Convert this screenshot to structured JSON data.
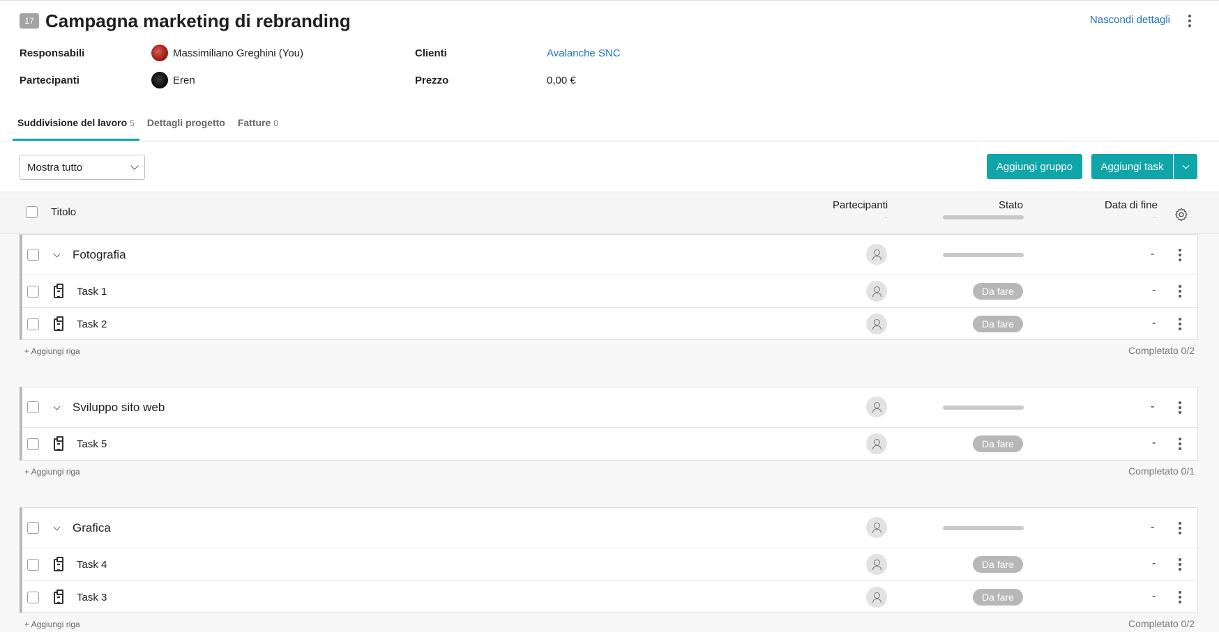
{
  "project": {
    "id": "17",
    "title": "Campagna marketing di rebranding",
    "hide_details": "Nascondi dettagli"
  },
  "info": {
    "responsabili_label": "Responsabili",
    "responsabili_value": "Massimiliano Greghini (You)",
    "partecipanti_label": "Partecipanti",
    "partecipanti_value": "Eren",
    "clienti_label": "Clienti",
    "clienti_value": "Avalanche SNC",
    "prezzo_label": "Prezzo",
    "prezzo_value": "0,00 €"
  },
  "tabs": [
    {
      "label": "Suddivisione del lavoro",
      "count": "5"
    },
    {
      "label": "Dettagli progetto",
      "count": ""
    },
    {
      "label": "Fatture",
      "count": "0"
    }
  ],
  "toolbar": {
    "filter_value": "Mostra tutto",
    "add_group": "Aggiungi gruppo",
    "add_task": "Aggiungi task"
  },
  "table_header": {
    "title": "Titolo",
    "participants": "Partecipanti",
    "participants_dash": "-",
    "status": "Stato",
    "end_date": "Data di fine",
    "end_date_dash": "-"
  },
  "groups": [
    {
      "name": "Fotografia",
      "date": "-",
      "tasks": [
        {
          "name": "Task 1",
          "status": "Da fare",
          "date": "-"
        },
        {
          "name": "Task 2",
          "status": "Da fare",
          "date": "-"
        }
      ],
      "add_row": "+ Aggiungi riga",
      "completed": "Completato 0/2"
    },
    {
      "name": "Sviluppo sito web",
      "date": "-",
      "tasks": [
        {
          "name": "Task 5",
          "status": "Da fare",
          "date": "-"
        }
      ],
      "add_row": "+ Aggiungi riga",
      "completed": "Completato 0/1"
    },
    {
      "name": "Grafica",
      "date": "-",
      "tasks": [
        {
          "name": "Task 4",
          "status": "Da fare",
          "date": "-"
        },
        {
          "name": "Task 3",
          "status": "Da fare",
          "date": "-"
        }
      ],
      "add_row": "+ Aggiungi riga",
      "completed": "Completato 0/2"
    }
  ],
  "colors": {
    "accent": "#0fa5a9",
    "link": "#1a73c9",
    "pill": "#b7b7b7"
  }
}
